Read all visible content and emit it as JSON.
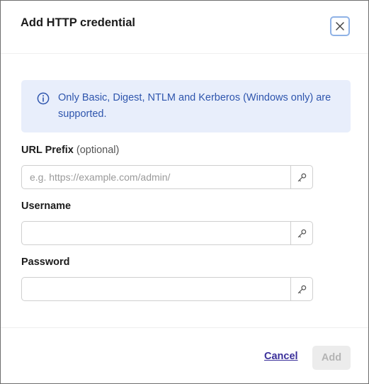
{
  "dialog": {
    "title": "Add HTTP credential",
    "close_icon": "close-icon"
  },
  "info": {
    "icon": "info-icon",
    "text": "Only Basic, Digest, NTLM and Kerberos (Windows only) are supported.",
    "background": "#e8eefb",
    "text_color": "#2e55ad"
  },
  "fields": {
    "url_prefix": {
      "label": "URL Prefix",
      "optional": "(optional)",
      "value": "",
      "placeholder": "e.g. https://example.com/admin/",
      "icon": "key-icon"
    },
    "username": {
      "label": "Username",
      "value": "",
      "placeholder": "",
      "icon": "key-icon"
    },
    "password": {
      "label": "Password",
      "value": "",
      "placeholder": "",
      "icon": "key-icon"
    }
  },
  "footer": {
    "cancel_label": "Cancel",
    "add_label": "Add",
    "cancel_color": "#3a2f9a"
  }
}
